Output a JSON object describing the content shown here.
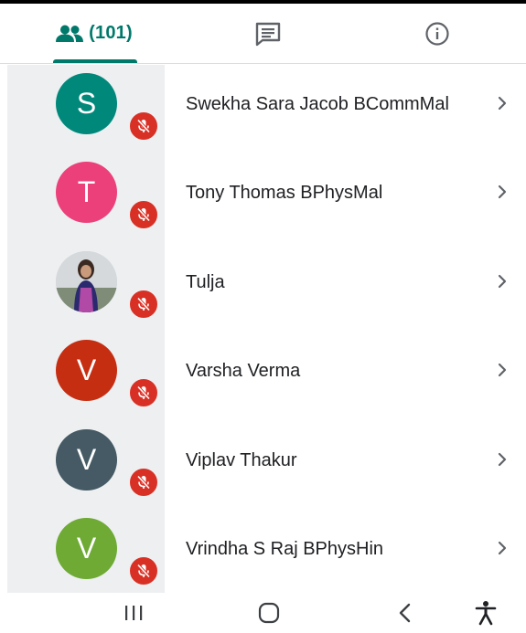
{
  "tabs": {
    "people_count": "(101)",
    "accent_color": "#00796b"
  },
  "participants": [
    {
      "initial": "S",
      "name": "Swekha Sara Jacob BCommMal",
      "color": "#00897b",
      "muted": true
    },
    {
      "initial": "T",
      "name": "Tony Thomas BPhysMal",
      "color": "#ec407a",
      "muted": true
    },
    {
      "initial": "",
      "name": "Tulja",
      "color": "#c9ccd1",
      "muted": true,
      "photo": true
    },
    {
      "initial": "V",
      "name": "Varsha Verma",
      "color": "#c62e12",
      "muted": true
    },
    {
      "initial": "V",
      "name": "Viplav Thakur",
      "color": "#455a64",
      "muted": true
    },
    {
      "initial": "V",
      "name": "Vrindha S Raj BPhysHin",
      "color": "#6eaa34",
      "muted": true
    }
  ],
  "nav": {
    "recents": "recents-icon",
    "home": "home-icon",
    "back": "back-icon",
    "accessibility": "accessibility-icon"
  }
}
